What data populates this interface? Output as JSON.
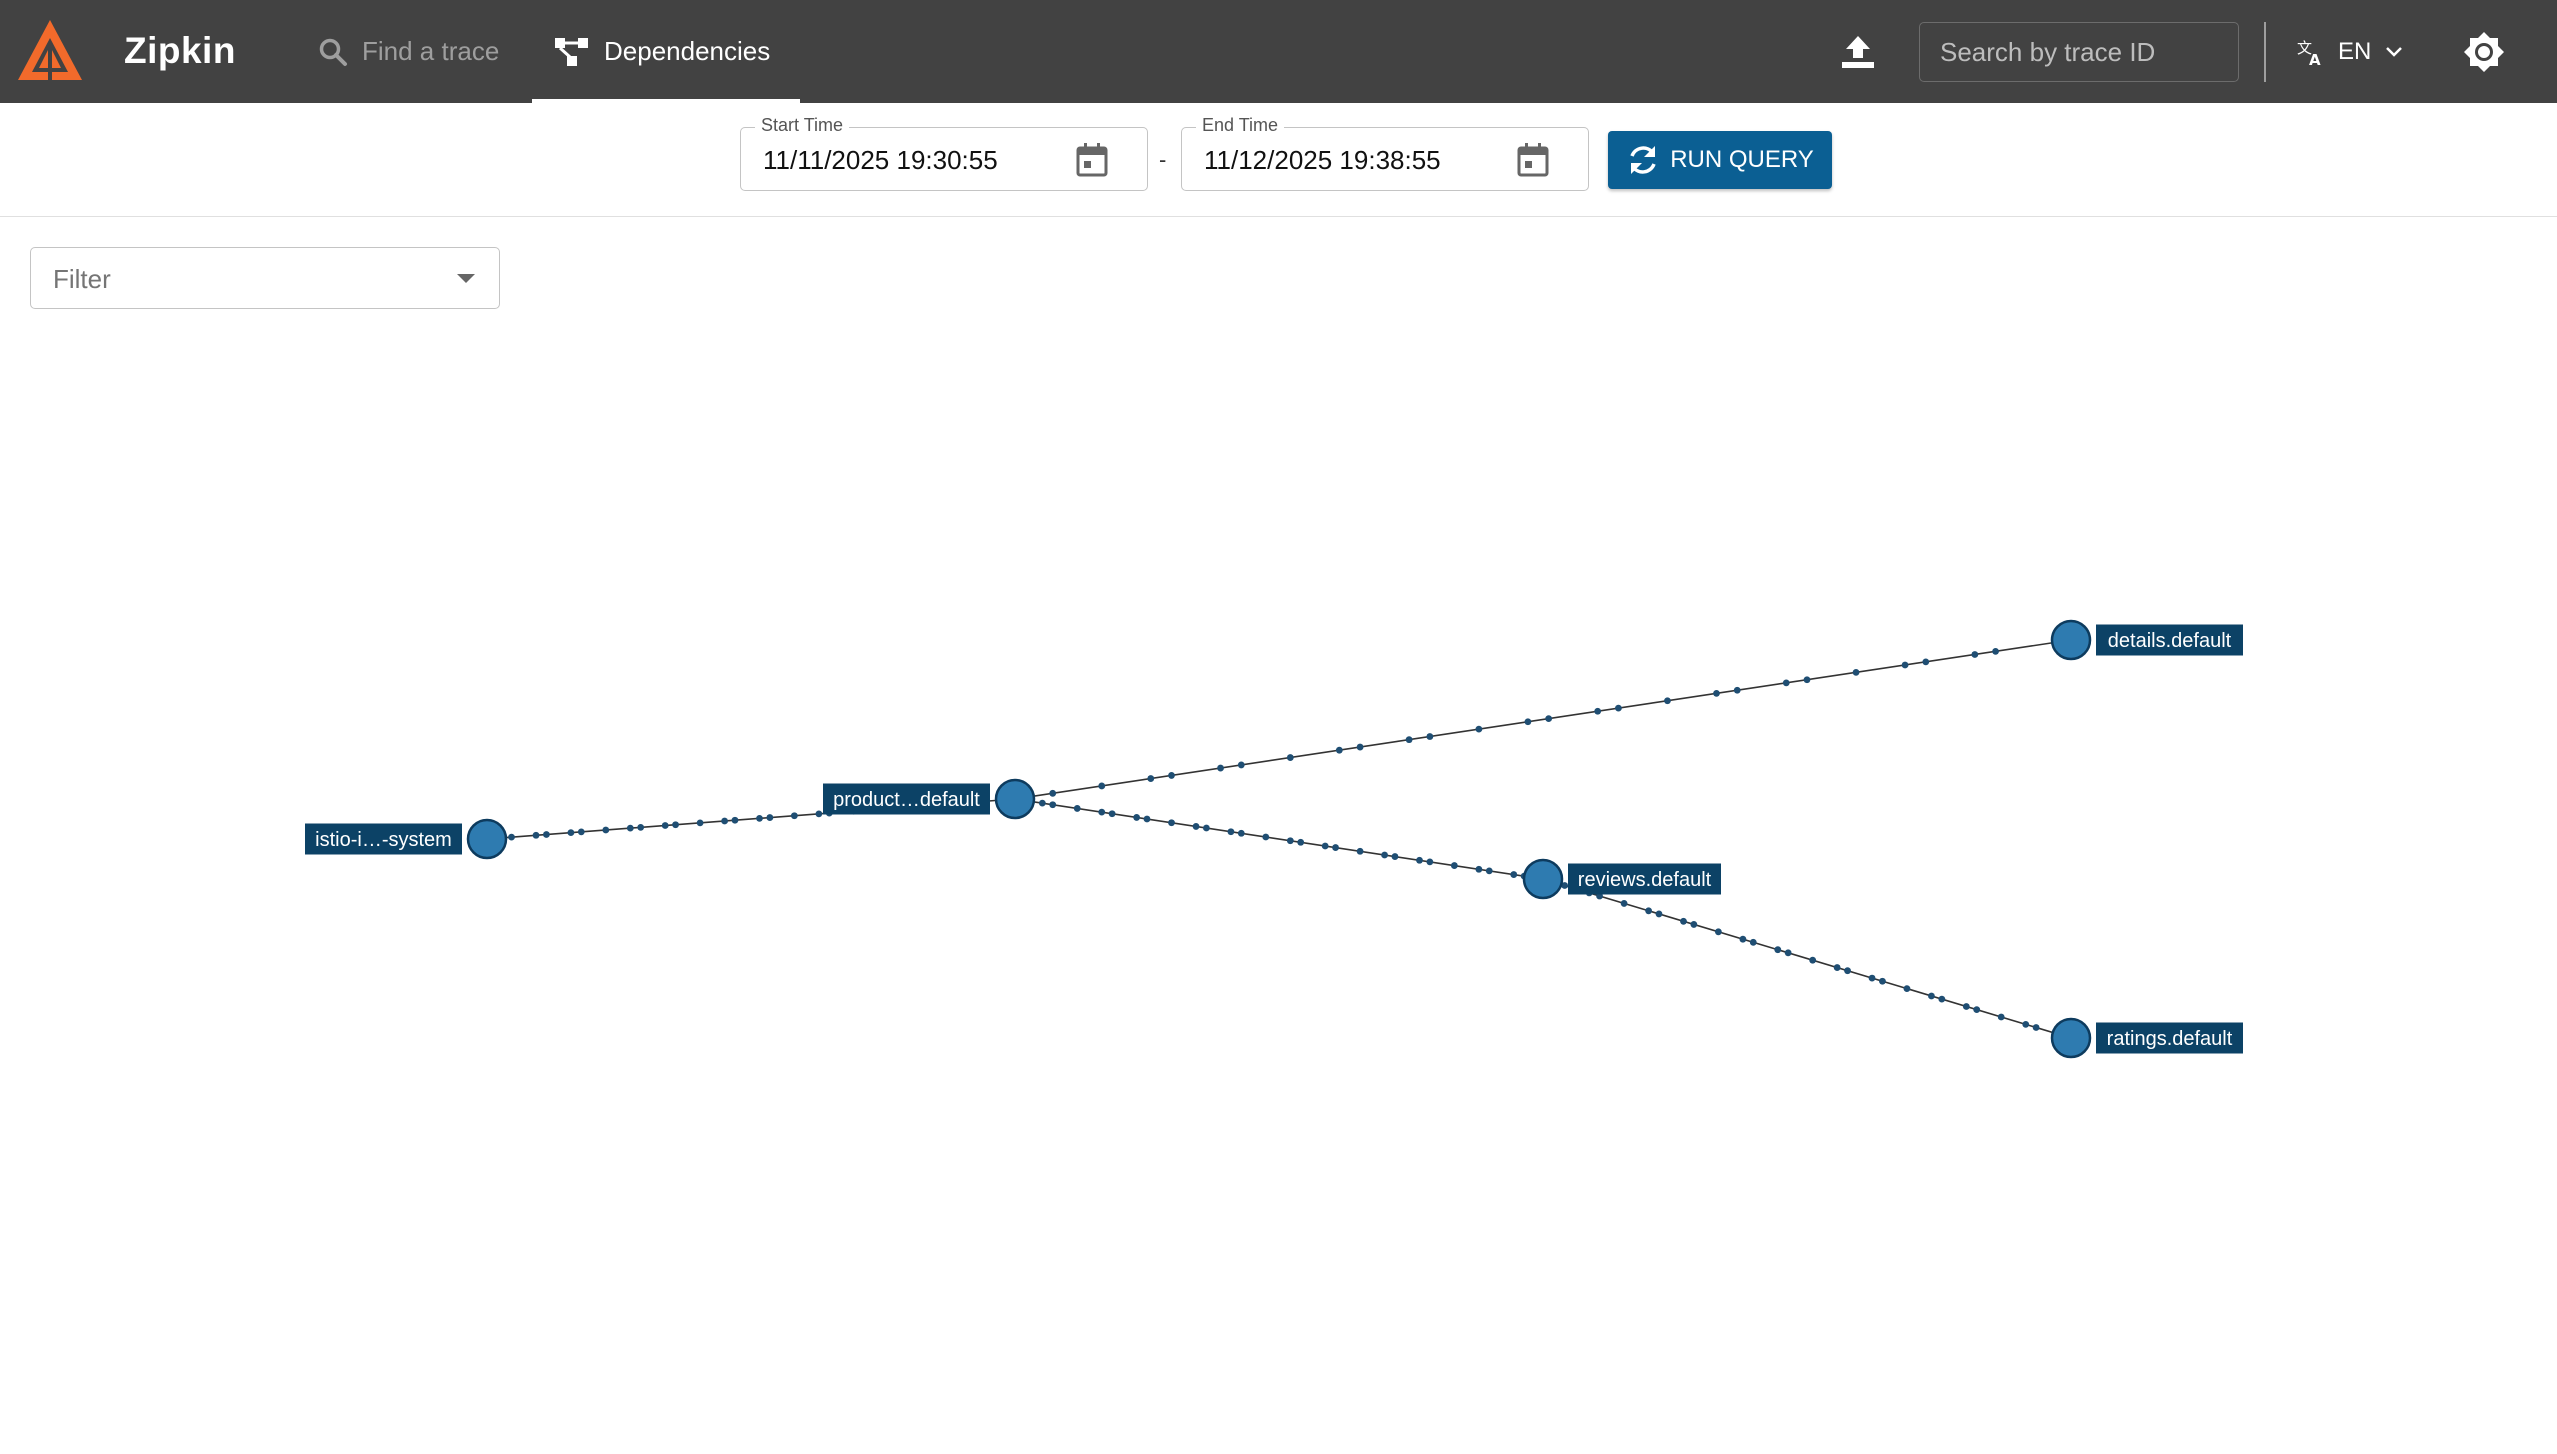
{
  "app": {
    "name": "Zipkin"
  },
  "nav": {
    "find_trace": "Find a trace",
    "dependencies": "Dependencies"
  },
  "header": {
    "search_placeholder": "Search by trace ID",
    "language": "EN"
  },
  "query": {
    "start_label": "Start Time",
    "start_value": "11/11/2025 19:30:55",
    "separator": "-",
    "end_label": "End Time",
    "end_value": "11/12/2025 19:38:55",
    "run_label": "RUN QUERY"
  },
  "filter": {
    "placeholder": "Filter"
  },
  "graph": {
    "colors": {
      "node": "#2e7bb0",
      "node_stroke": "#0d3b5e",
      "label_bg": "#0c4266",
      "edge": "#333333",
      "dot": "#1f4e73"
    },
    "nodes": [
      {
        "id": "istio",
        "label": "istio-i…-system",
        "label_side": "left"
      },
      {
        "id": "productpage",
        "label": "product…default",
        "label_side": "left"
      },
      {
        "id": "details",
        "label": "details.default",
        "label_side": "right"
      },
      {
        "id": "reviews",
        "label": "reviews.default",
        "label_side": "right"
      },
      {
        "id": "ratings",
        "label": "ratings.default",
        "label_side": "right"
      }
    ],
    "edges": [
      {
        "from": "istio",
        "to": "productpage"
      },
      {
        "from": "productpage",
        "to": "details"
      },
      {
        "from": "productpage",
        "to": "reviews"
      },
      {
        "from": "reviews",
        "to": "ratings"
      }
    ]
  }
}
